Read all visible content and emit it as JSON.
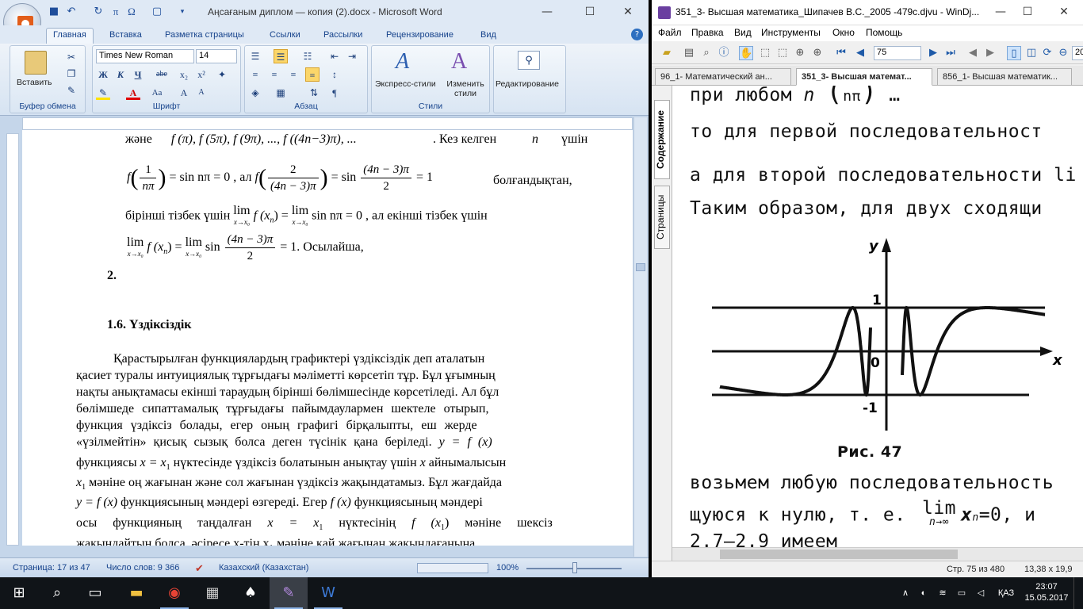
{
  "word": {
    "title": "Аңсағаным диплом — копия (2).docx - Microsoft Word",
    "tabs": [
      "Главная",
      "Вставка",
      "Разметка страницы",
      "Ссылки",
      "Рассылки",
      "Рецензирование",
      "Вид"
    ],
    "active_tab": "Главная",
    "ribbon": {
      "paste_label": "Вставить",
      "clipboard_label": "Буфер обмена",
      "font_name": "Times New Roman",
      "font_size": "14",
      "font_label": "Шрифт",
      "paragraph_label": "Абзац",
      "quick_styles_label": "Экспресс-стили",
      "change_styles_label": "Изменить стили",
      "styles_label": "Стили",
      "editing_label": "Редактирование"
    },
    "doc": {
      "line_top": "және",
      "line_top_tail": ". Кез келген",
      "line_top_n": "n",
      "line_top_end": "үшін",
      "frac_1pi_num": "1",
      "frac_1pi_den": "nπ",
      "eq1_mid": "= sin nπ = 0 , ал",
      "frac_2_num": "2",
      "frac_2_den": "(4n − 3)π",
      "eq1_right": "= sin",
      "frac_4n_num": "(4n − 3)π",
      "frac_4n_den": "2",
      "eq1_end": "= 1",
      "eq1_word": "болғандықтан,",
      "line3_a": "бірінші тізбек үшін",
      "line3_lim": "lim",
      "line3_limsub": "x→x₀",
      "line3_b": "f (x",
      "line3_b2": ") =",
      "line3_c": "sin nπ = 0 , ал екінші тізбек үшін",
      "line4_end": "= 1",
      "line4_word": ". Осылайша,",
      "item2": "2.",
      "heading": "1.6. Үздіксіздік",
      "p1": "Қарастырылған функциялардың графиктері үздіксіздік деп аталатын",
      "p2": "қасиет туралы интуициялық тұрғыдағы мәліметті көрсетіп тұр. Бұл ұғымның",
      "p3": "нақты анықтамасы екінші тараудың бірінші бөлімшесінде көрсетіледі. Ал бұл",
      "p4": "бөлімшеде сипаттамалық тұрғыдағы пайымдаулармен шектеле отырып,",
      "p5": "функция үздіксіз болады, егер оның графигі бірқалыпты, еш жерде",
      "p6": "«үзілмейтін» қисық сызық болса деген түсінік қана беріледі.",
      "p6_math": "y = f (x)",
      "p7_a": "функциясы",
      "p7_math": "x = x",
      "p7_b": "нүктесінде үздіксіз болатынын анықтау үшін",
      "p7_x": "x",
      "p7_c": "айнымалысын",
      "p8_x1": "x",
      "p8": "мәніне оң жағынан және сол жағынан үздіксіз жақындатамыз. Бұл жағдайда",
      "p9_math": "y = f (x)",
      "p9_a": "функциясының мәндері өзгереді. Егер",
      "p9_math2": "f (x)",
      "p9_b": "функциясының мәндері",
      "p10_a": "осы функцияның таңдалған",
      "p10_math": "x = x",
      "p10_b": "нүктесінің",
      "p10_math2": "f (x",
      "p10_c": "мәніне шексіз",
      "p11": "жақындайтын болса, әсіресе x-тің x₁ мәніне қай жағынан жақындағанына"
    },
    "status": {
      "page": "Страница: 17 из 47",
      "words": "Число слов: 9 366",
      "language": "Казахский (Казахстан)",
      "zoom": "100%"
    }
  },
  "djview": {
    "title": "351_3- Высшая математика_Шипачев В.С._2005 -479с.djvu - WinDj...",
    "menu": [
      "Файл",
      "Правка",
      "Вид",
      "Инструменты",
      "Окно",
      "Помощь"
    ],
    "page_input": "75",
    "zoom_input": "20",
    "tabs": [
      "96_1- Математический ан...",
      "351_3- Высшая математ...",
      "856_1- Высшая математик..."
    ],
    "side_tabs": [
      "Содержание",
      "Страницы"
    ],
    "text": {
      "l0": "при любом",
      "l1": "то  для  первой  последовательност",
      "l2": "а для  второй последовательности  li",
      "l3": "Таким  образом,  для  двух  сходящи",
      "caption": "Рис.  47",
      "l4": "возьмем  любую  последовательность",
      "l5a": "щуюся  к  нулю,  т. е.",
      "l5lim": "lim",
      "l5sub": "n→∞",
      "l5b": "x",
      "l5c": "=0,  и",
      "l6": "2.7—2.9  имеем"
    },
    "figure": {
      "y_label": "y",
      "x_label": "x",
      "tick_1": "1",
      "tick_0": "0",
      "tick_m1": "-1"
    },
    "status": {
      "page": "Стр. 75 из 480",
      "size": "13,38 x 19,9"
    }
  },
  "taskbar": {
    "lang": "ҚАЗ",
    "time": "23:07",
    "date": "15.05.2017"
  }
}
